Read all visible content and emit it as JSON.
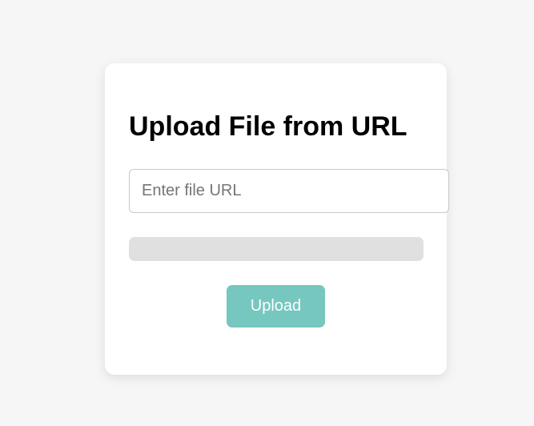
{
  "card": {
    "title": "Upload File from URL",
    "url_input": {
      "value": "",
      "placeholder": "Enter file URL"
    },
    "progress": {
      "percent": 0
    },
    "upload_button": {
      "label": "Upload"
    }
  },
  "colors": {
    "accent": "#76c7bf",
    "progress_track": "#e0e0e0",
    "background": "#f6f6f6"
  }
}
